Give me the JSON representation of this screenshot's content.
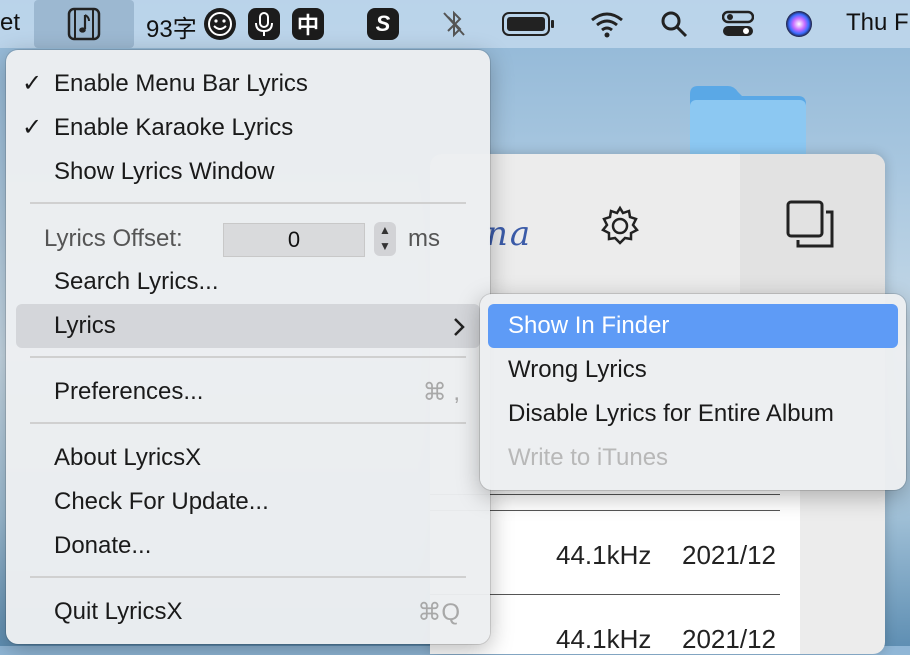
{
  "menubar": {
    "left_fragment": "et",
    "input_count": "93字",
    "ime_label": "中",
    "s_badge": "S",
    "clock": "Thu F",
    "icons": [
      "lyricsx-app-icon",
      "emoji-icon",
      "microphone-icon",
      "bluetooth-icon",
      "battery-icon",
      "wifi-icon",
      "search-icon",
      "control-center-icon",
      "siri-icon"
    ]
  },
  "main_menu": {
    "enable_menu_bar_lyrics": "Enable Menu Bar Lyrics",
    "enable_karaoke_lyrics": "Enable Karaoke Lyrics",
    "show_lyrics_window": "Show Lyrics Window",
    "offset_label": "Lyrics Offset:",
    "offset_value": "0",
    "offset_unit": "ms",
    "search_lyrics": "Search Lyrics...",
    "lyrics": "Lyrics",
    "preferences": "Preferences...",
    "preferences_shortcut": "⌘ ,",
    "about": "About LyricsX",
    "check_update": "Check For Update...",
    "donate": "Donate...",
    "quit": "Quit LyricsX",
    "quit_shortcut": "⌘Q",
    "check_glyph": "✓",
    "submenu_arrow": "›"
  },
  "lyrics_submenu": {
    "show_in_finder": "Show In Finder",
    "wrong_lyrics": "Wrong Lyrics",
    "disable_album": "Disable Lyrics for Entire Album",
    "write_itunes": "Write to iTunes"
  },
  "background": {
    "script_fragment": "na",
    "rows": [
      {
        "rate": "44.1kHz",
        "date": "2021/12"
      },
      {
        "rate": "44.1kHz",
        "date": "2021/12"
      }
    ]
  },
  "colors": {
    "highlight": "#5e9bf6",
    "menu_bg": "#eceef1"
  }
}
